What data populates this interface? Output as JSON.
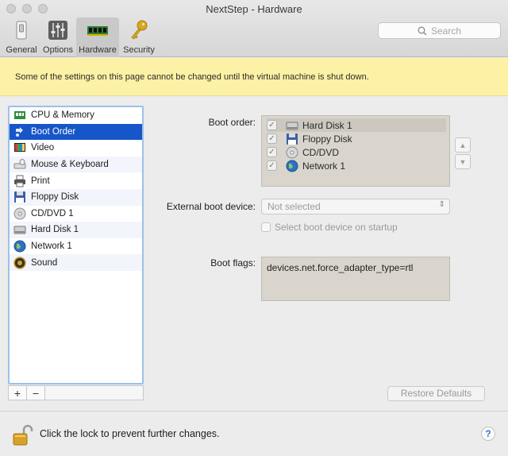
{
  "window": {
    "title": "NextStep - Hardware"
  },
  "toolbar": {
    "tabs": [
      {
        "label": "General",
        "icon": "switch-icon",
        "active": false
      },
      {
        "label": "Options",
        "icon": "sliders-icon",
        "active": false
      },
      {
        "label": "Hardware",
        "icon": "memory-chip-icon",
        "active": true
      },
      {
        "label": "Security",
        "icon": "key-icon",
        "active": false
      }
    ],
    "search_placeholder": "Search"
  },
  "banner": {
    "text": "Some of the settings on this page cannot be changed until the virtual machine is shut down."
  },
  "sidebar": {
    "items": [
      {
        "label": "CPU & Memory",
        "icon": "cpu-memory-icon",
        "selected": false
      },
      {
        "label": "Boot Order",
        "icon": "boot-order-icon",
        "selected": true
      },
      {
        "label": "Video",
        "icon": "video-icon",
        "selected": false
      },
      {
        "label": "Mouse & Keyboard",
        "icon": "keyboard-icon",
        "selected": false
      },
      {
        "label": "Print",
        "icon": "printer-icon",
        "selected": false
      },
      {
        "label": "Floppy Disk",
        "icon": "floppy-disk-icon",
        "selected": false
      },
      {
        "label": "CD/DVD 1",
        "icon": "cd-dvd-icon",
        "selected": false
      },
      {
        "label": "Hard Disk 1",
        "icon": "hard-disk-icon",
        "selected": false
      },
      {
        "label": "Network 1",
        "icon": "network-globe-icon",
        "selected": false
      },
      {
        "label": "Sound",
        "icon": "speaker-icon",
        "selected": false
      }
    ],
    "add_label": "+",
    "remove_label": "−"
  },
  "boot": {
    "order_label": "Boot order:",
    "order": [
      {
        "label": "Hard Disk 1",
        "checked": true,
        "icon": "hard-disk-icon"
      },
      {
        "label": "Floppy Disk",
        "checked": true,
        "icon": "floppy-disk-icon"
      },
      {
        "label": "CD/DVD",
        "checked": true,
        "icon": "cd-dvd-icon"
      },
      {
        "label": "Network 1",
        "checked": true,
        "icon": "network-globe-icon"
      }
    ],
    "external_label": "External boot device:",
    "external_value": "Not selected",
    "startup_label": "Select boot device on startup",
    "flags_label": "Boot flags:",
    "flags_value": "devices.net.force_adapter_type=rtl"
  },
  "restore_label": "Restore Defaults",
  "footer": {
    "lock_text": "Click the lock to prevent further changes.",
    "help_label": "?"
  }
}
